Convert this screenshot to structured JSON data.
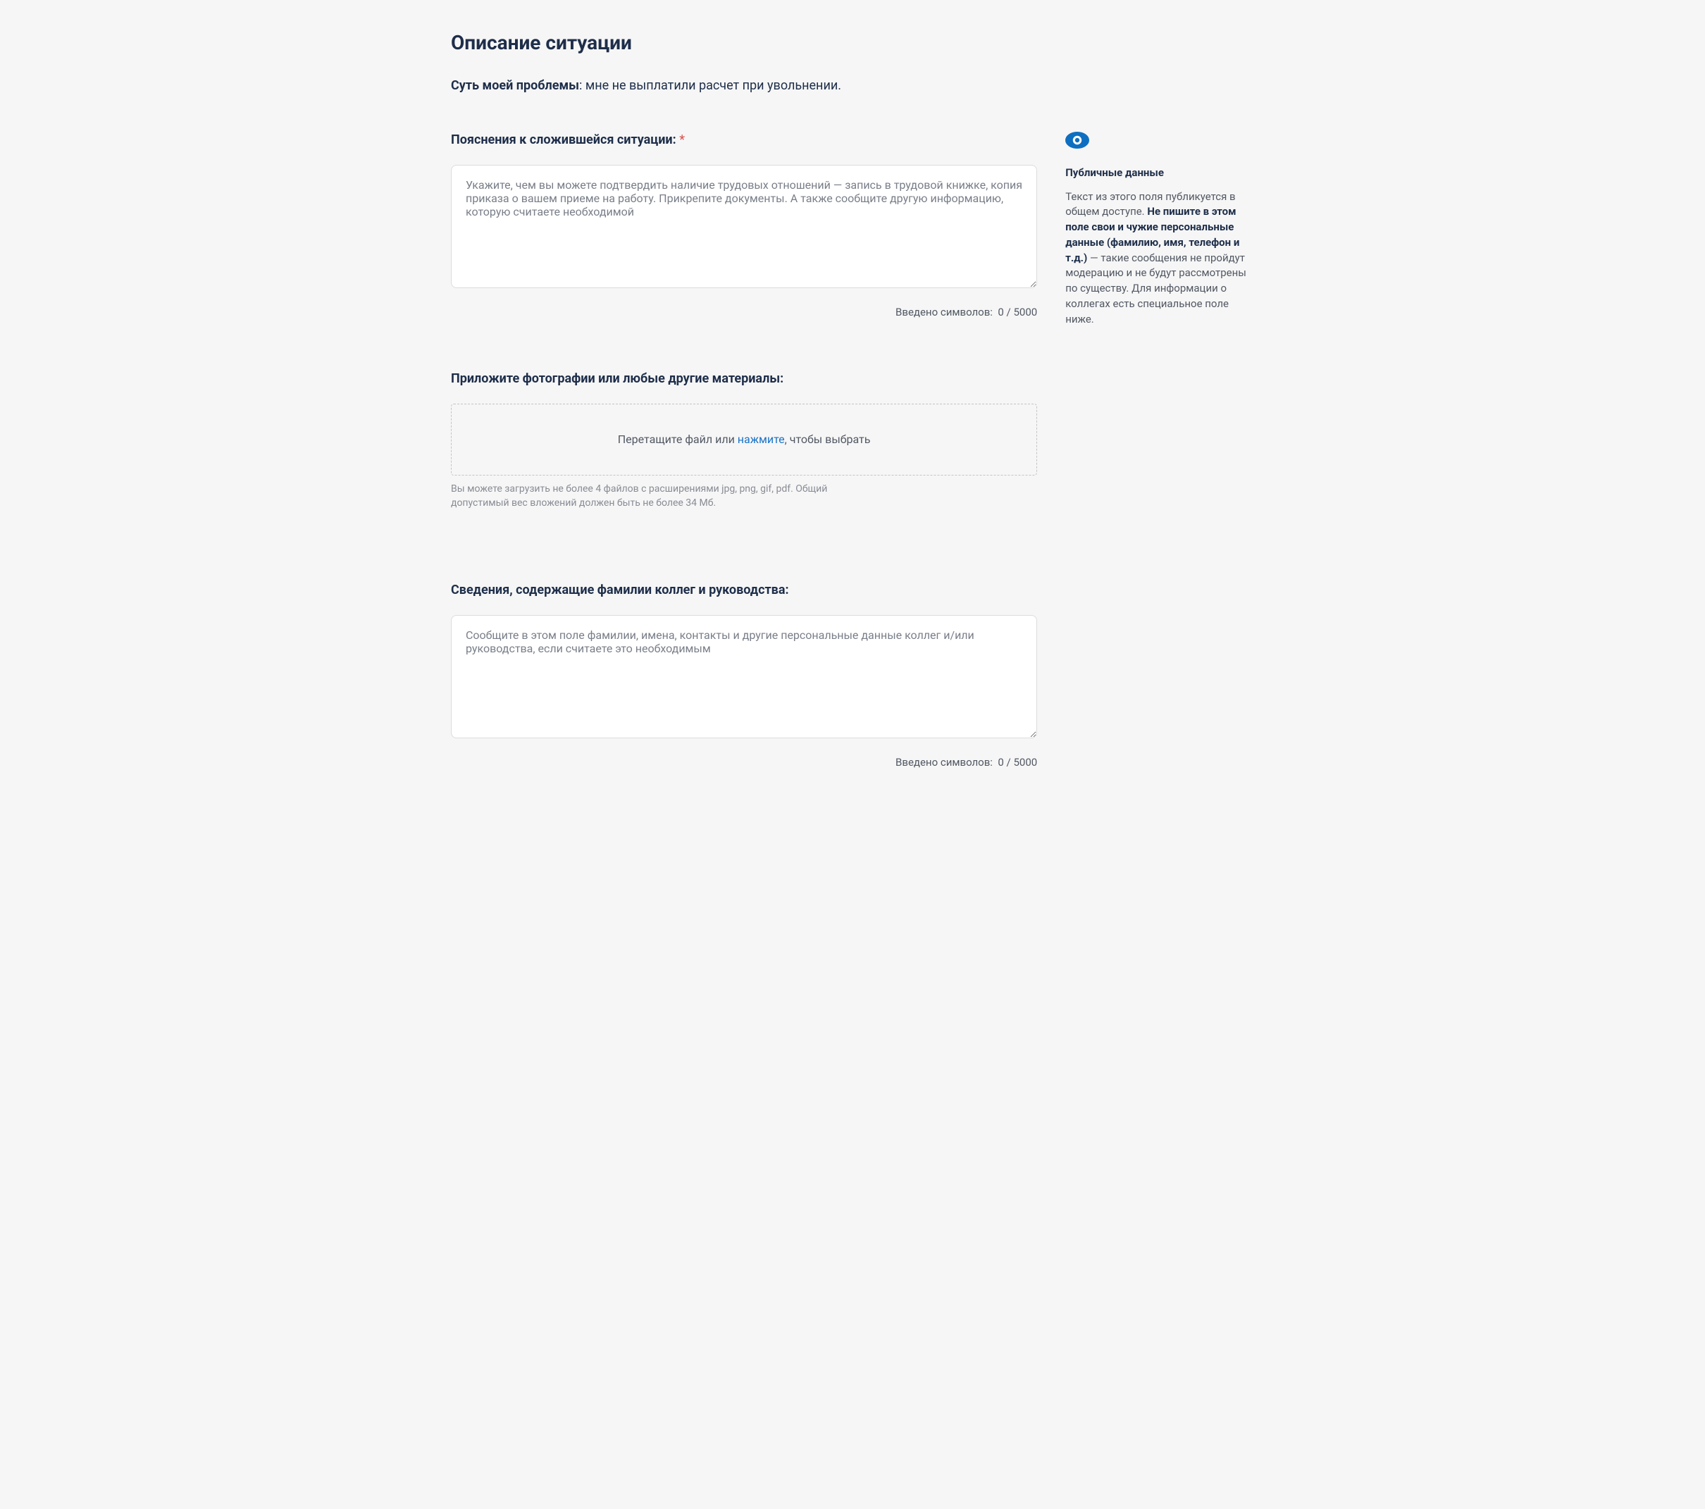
{
  "heading": "Описание ситуации",
  "problem": {
    "label": "Суть моей проблемы",
    "separator": ": ",
    "text": "мне не выплатили расчет при увольнении."
  },
  "explanation": {
    "label": "Пояснения к сложившейся ситуации:",
    "required_mark": "*",
    "placeholder": "Укажите, чем вы можете подтвердить наличие трудовых отношений — запись в трудовой книжке, копия приказа о вашем приеме на работу. Прикрепите документы. А также сообщите другую информацию, которую считаете необходимой",
    "counter_label": "Введено символов:",
    "counter_value": "0 / 5000"
  },
  "public_aside": {
    "title": "Публичные данные",
    "text_before": "Текст из этого поля публикуется в общем доступе. ",
    "text_bold": "Не пишите в этом поле свои и чужие персональные данные (фамилию, имя, телефон и т.д.)",
    "text_after": " — такие сообщения не пройдут модерацию и не будут рассмотрены по существу. Для информации о коллегах есть специальное поле ниже."
  },
  "attachments": {
    "label": "Приложите фотографии или любые другие материалы:",
    "dropzone_before": "Перетащите файл или ",
    "dropzone_link": "нажмите",
    "dropzone_after": ", чтобы выбрать",
    "hint": "Вы можете загрузить не более 4 файлов с расширениями jpg, png, gif, pdf. Общий допустимый вес вложений должен быть не более 34 Мб."
  },
  "colleagues": {
    "label": "Сведения, содержащие фамилии коллег и руководства:",
    "placeholder": "Сообщите в этом поле фамилии, имена, контакты и другие персональные данные коллег и/или руководства, если считаете это необходимым",
    "counter_label": "Введено символов:",
    "counter_value": "0 / 5000"
  }
}
